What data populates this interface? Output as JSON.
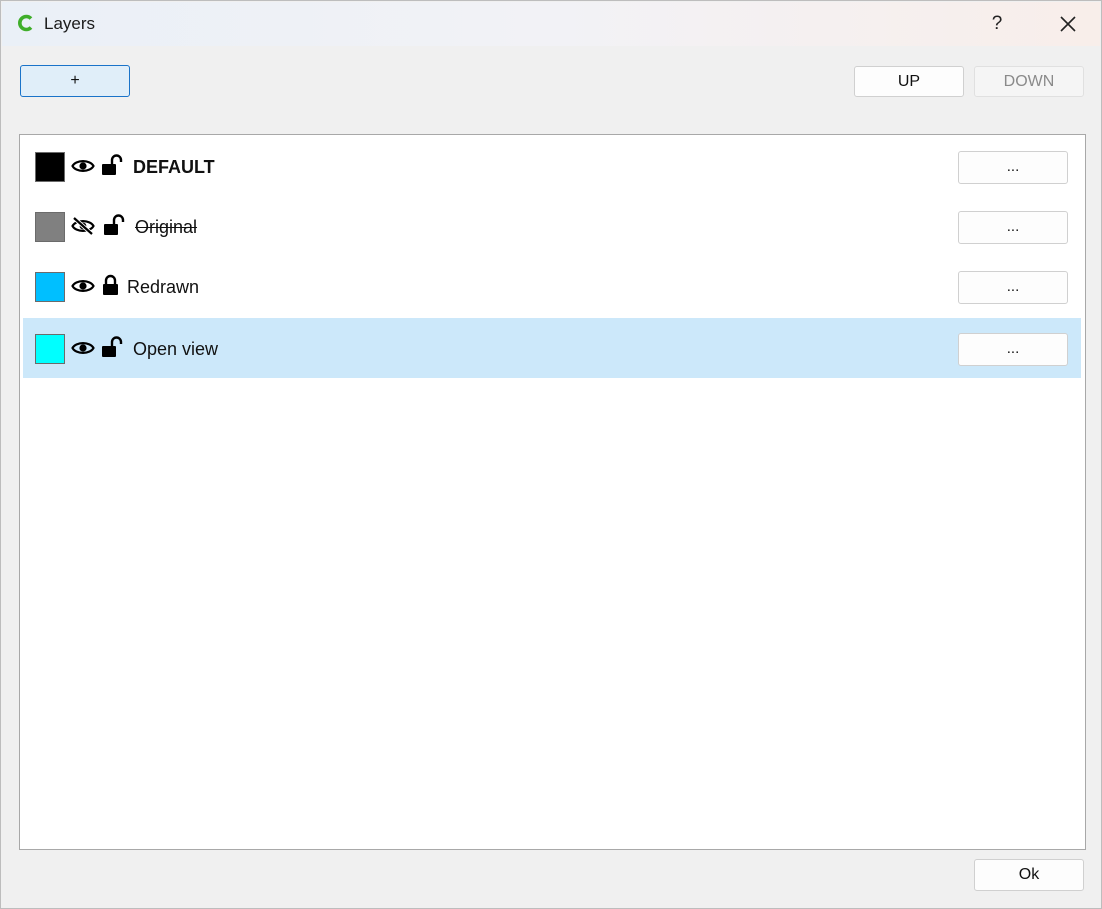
{
  "window": {
    "title": "Layers",
    "help_label": "?"
  },
  "toolbar": {
    "add_label": "+",
    "up_label": "UP",
    "down_label": "DOWN"
  },
  "layers": [
    {
      "name": "DEFAULT",
      "color": "#000000",
      "visible": true,
      "locked": false,
      "bold": true,
      "strikethrough": false,
      "more_label": "...",
      "eye_icon": "eye-icon",
      "lock_icon": "unlock-icon"
    },
    {
      "name": "Original",
      "color": "#808080",
      "visible": false,
      "locked": false,
      "bold": false,
      "strikethrough": true,
      "more_label": "...",
      "eye_icon": "eye-off-icon",
      "lock_icon": "unlock-icon"
    },
    {
      "name": "Redrawn",
      "color": "#00bfff",
      "visible": true,
      "locked": true,
      "bold": false,
      "strikethrough": false,
      "more_label": "...",
      "eye_icon": "eye-icon",
      "lock_icon": "lock-icon"
    },
    {
      "name": "Open view",
      "color": "#00ffff",
      "visible": true,
      "locked": false,
      "bold": false,
      "strikethrough": false,
      "selected": true,
      "more_label": "...",
      "eye_icon": "eye-icon",
      "lock_icon": "unlock-icon"
    }
  ],
  "footer": {
    "ok_label": "Ok"
  }
}
